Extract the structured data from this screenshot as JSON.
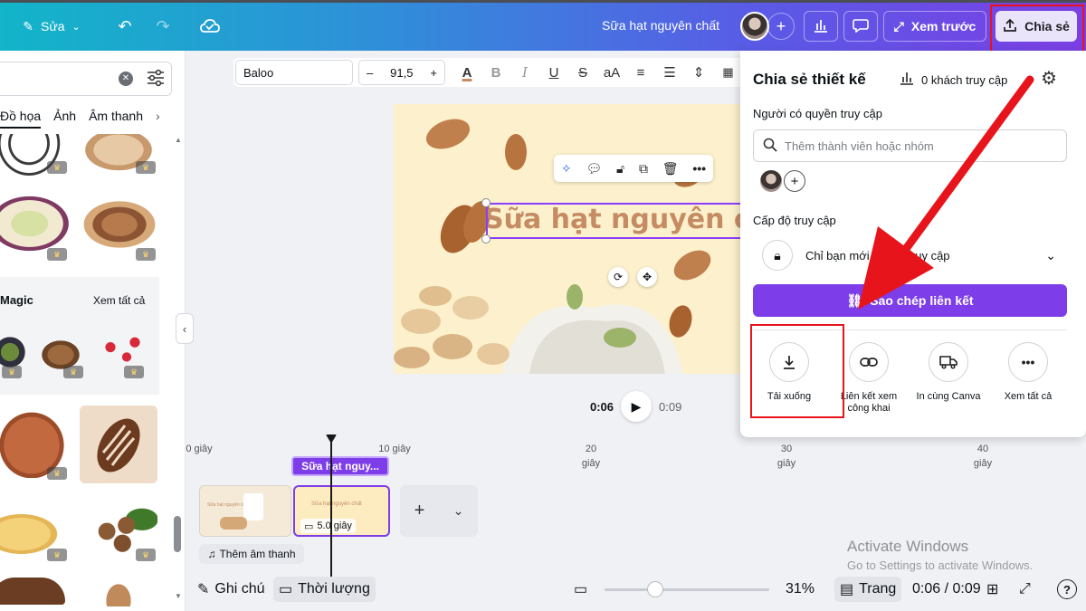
{
  "topbar": {
    "edit_label": "Sửa",
    "doc_title": "Sữa hạt nguyên chất",
    "preview_label": "Xem trước",
    "share_label": "Chia sẻ"
  },
  "left_panel": {
    "tabs": [
      "Đồ họa",
      "Ảnh",
      "Âm thanh"
    ],
    "section_title": "Magic",
    "see_all": "Xem tất cả"
  },
  "format_bar": {
    "font": "Baloo",
    "size": "91,5",
    "case_label": "aA"
  },
  "canvas": {
    "title_text": "Sữa hạt nguyên chất"
  },
  "playback": {
    "current": "0:06",
    "total": "0:09"
  },
  "timeline": {
    "ruler": [
      {
        "label": "0 giây",
        "sub": ""
      },
      {
        "label": "10 giây",
        "sub": ""
      },
      {
        "label": "20",
        "sub": "giây"
      },
      {
        "label": "30",
        "sub": "giây"
      },
      {
        "label": "40",
        "sub": "giây"
      }
    ],
    "clip_label": "Sữa hạt nguy...",
    "clip_duration": "5.0 giây",
    "clip_mini_title": "Sữa hạt nguyên chất",
    "add_audio": "Thêm âm thanh"
  },
  "bottombar": {
    "notes": "Ghi chú",
    "duration": "Thời lượng",
    "zoom": "31%",
    "pages": "Trang",
    "time": "0:06 / 0:09",
    "help": "?"
  },
  "watermark": {
    "line1": "Activate Windows",
    "line2": "Go to Settings to activate Windows."
  },
  "share_panel": {
    "title": "Chia sẻ thiết kế",
    "visitors": "0 khách truy cập",
    "people_label": "Người có quyền truy cập",
    "search_placeholder": "Thêm thành viên hoặc nhóm",
    "access_level_label": "Cấp độ truy cập",
    "access_value": "Chỉ bạn mới có thể truy cập",
    "copy_link": "Sao chép liên kết",
    "options": [
      {
        "label": "Tải xuống",
        "icon": "download-icon"
      },
      {
        "label": "Liên kết xem công khai",
        "icon": "link-icon"
      },
      {
        "label": "In cùng Canva",
        "icon": "truck-icon"
      },
      {
        "label": "Xem tất cả",
        "icon": "more-icon"
      }
    ]
  },
  "colors": {
    "accent": "#7d3de8",
    "annotation": "#e8141c"
  }
}
